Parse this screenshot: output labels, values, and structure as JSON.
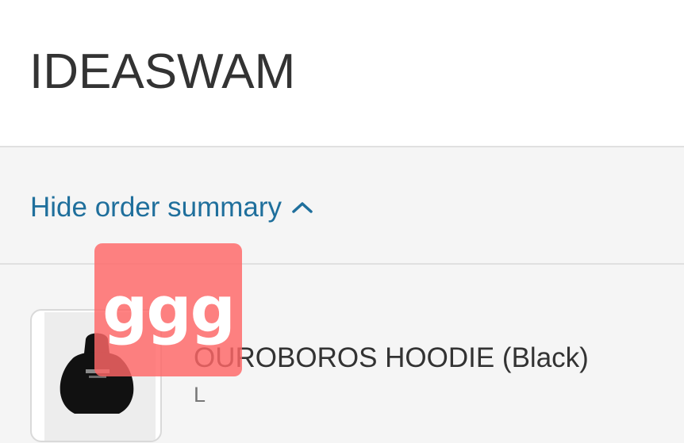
{
  "header": {
    "brand": "IDEASWAM"
  },
  "summary_toggle": {
    "label": "Hide order summary",
    "icon": "chevron-up-icon"
  },
  "order_summary": {
    "items": [
      {
        "name": "OUROBOROS HOODIE (Black)",
        "variant": "L",
        "thumbnail": "hoodie-image"
      }
    ]
  },
  "overlay": {
    "text": "ggg"
  },
  "colors": {
    "link": "#1f6f9c",
    "text": "#333333",
    "muted": "#777777",
    "panel_bg": "#f5f5f5",
    "overlay": "#ff6666"
  }
}
